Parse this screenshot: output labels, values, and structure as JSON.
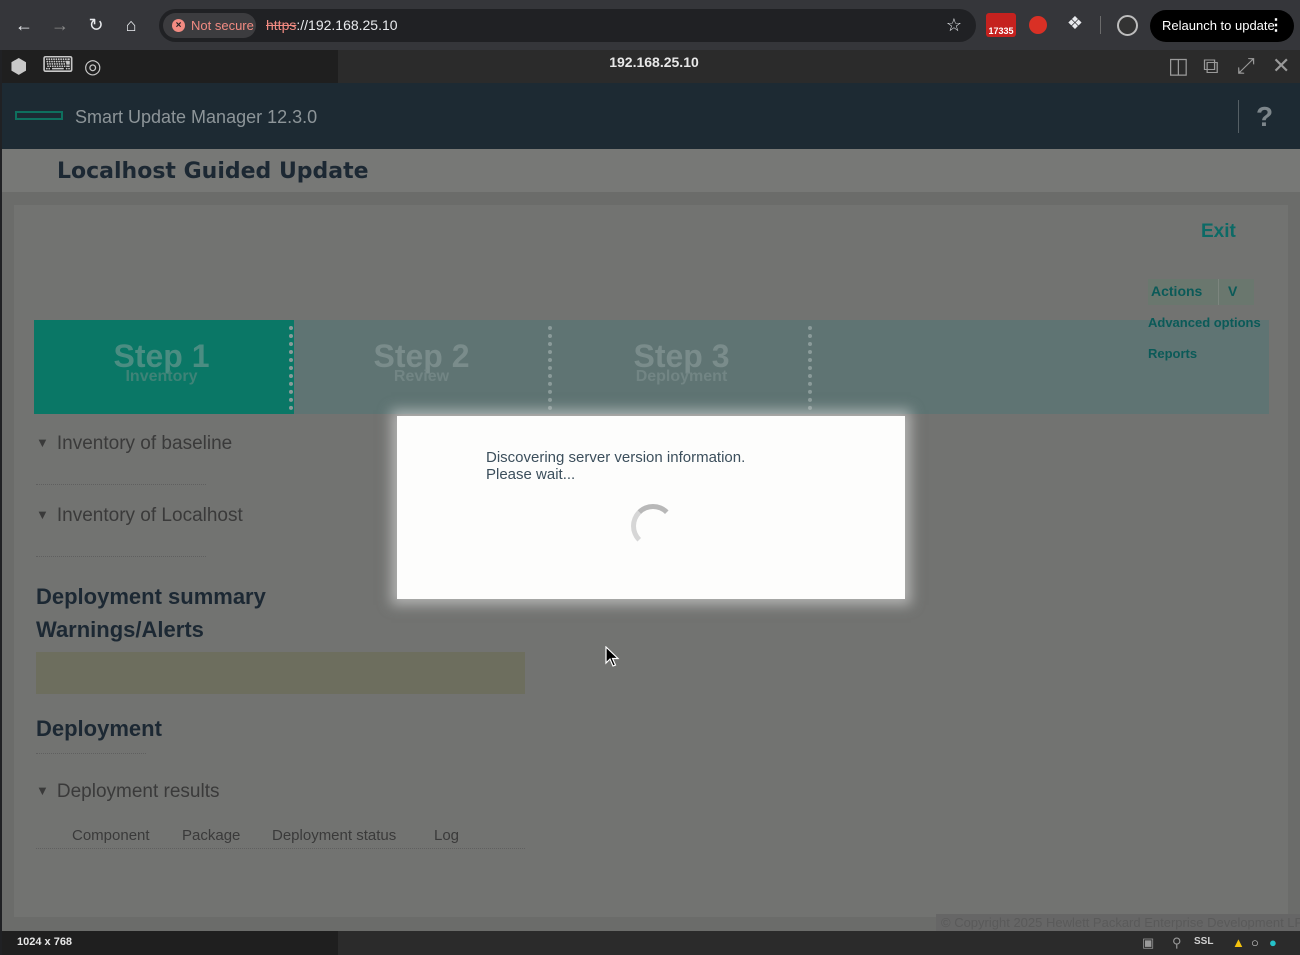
{
  "browser": {
    "security_label": "Not secure",
    "url_scheme": "https",
    "url_rest": "://192.168.25.10",
    "extension_badge": "17335",
    "relaunch_label": "Relaunch to update"
  },
  "console": {
    "title": "192.168.25.10",
    "resolution": "1024 x 768",
    "ssl_label": "SSL"
  },
  "app": {
    "product_title": "Smart Update Manager 12.3.0",
    "help_label": "?",
    "page_title": "Localhost Guided Update",
    "exit_label": "Exit",
    "actions_label": "Actions",
    "actions_caret": "V",
    "advanced_options_label": "Advanced options",
    "reports_label": "Reports",
    "steps": [
      {
        "number": "Step 1",
        "label": "Inventory",
        "active": true
      },
      {
        "number": "Step 2",
        "label": "Review",
        "active": false
      },
      {
        "number": "Step 3",
        "label": "Deployment",
        "active": false
      }
    ],
    "sections": {
      "inventory_baseline": "Inventory of baseline",
      "inventory_localhost": "Inventory of Localhost",
      "deployment_summary": "Deployment summary",
      "warnings_alerts": "Warnings/Alerts",
      "deployment": "Deployment",
      "deployment_results": "Deployment results"
    },
    "results_columns": [
      "Component",
      "Package",
      "Deployment status",
      "Log"
    ],
    "copyright": "© Copyright 2025 Hewlett Packard Enterprise Development LP"
  },
  "modal": {
    "line1": "Discovering server version information.",
    "line2": "Please wait..."
  },
  "colors": {
    "accent": "#01a982",
    "active_step": "#0a7766",
    "overlay_bg": "#6b6c6a"
  }
}
